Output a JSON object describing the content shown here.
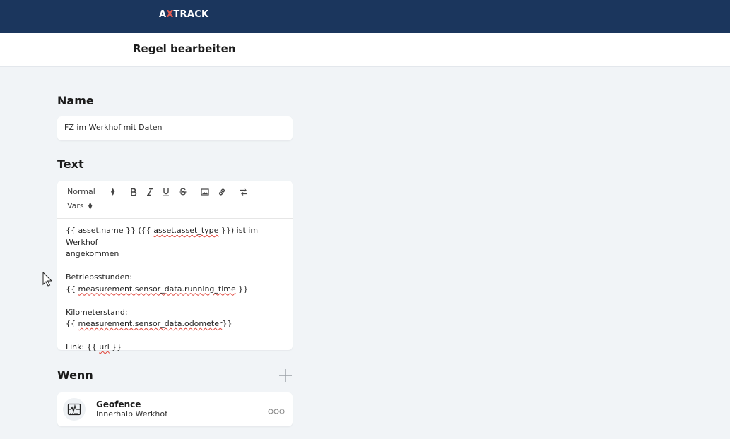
{
  "header": {
    "logo_text": "AXTRACK",
    "logo_prefix": "A",
    "logo_mark": "X",
    "logo_suffix": "TRACK"
  },
  "subheader": {
    "title": "Regel bearbeiten"
  },
  "name_section": {
    "label": "Name",
    "value": "FZ im Werkhof mit Daten"
  },
  "text_section": {
    "label": "Text",
    "toolbar": {
      "format_select": "Normal",
      "vars_select": "Vars",
      "buttons": [
        "bold-icon",
        "italic-icon",
        "underline-icon",
        "strikethrough-icon",
        "image-icon",
        "link-icon",
        "clear-format-icon"
      ]
    },
    "lines": [
      "{{ asset.name }} ({{ asset.asset_type }}) ist im Werkhof",
      "angekommen",
      "",
      "Betriebsstunden:",
      "{{ measurement.sensor_data.running_time }}",
      "",
      "Kilometerstand:",
      "{{ measurement.sensor_data.odometer}}",
      "",
      "Link: {{ url }}"
    ]
  },
  "wenn_section": {
    "label": "Wenn",
    "condition": {
      "title": "Geofence",
      "subtitle": "Innerhalb Werkhof",
      "icon": "activity-monitor-icon"
    }
  },
  "colors": {
    "header_bg": "#1b365d",
    "page_bg": "#f1f4f7",
    "card_bg": "#ffffff",
    "spell_error": "#e0443a"
  }
}
